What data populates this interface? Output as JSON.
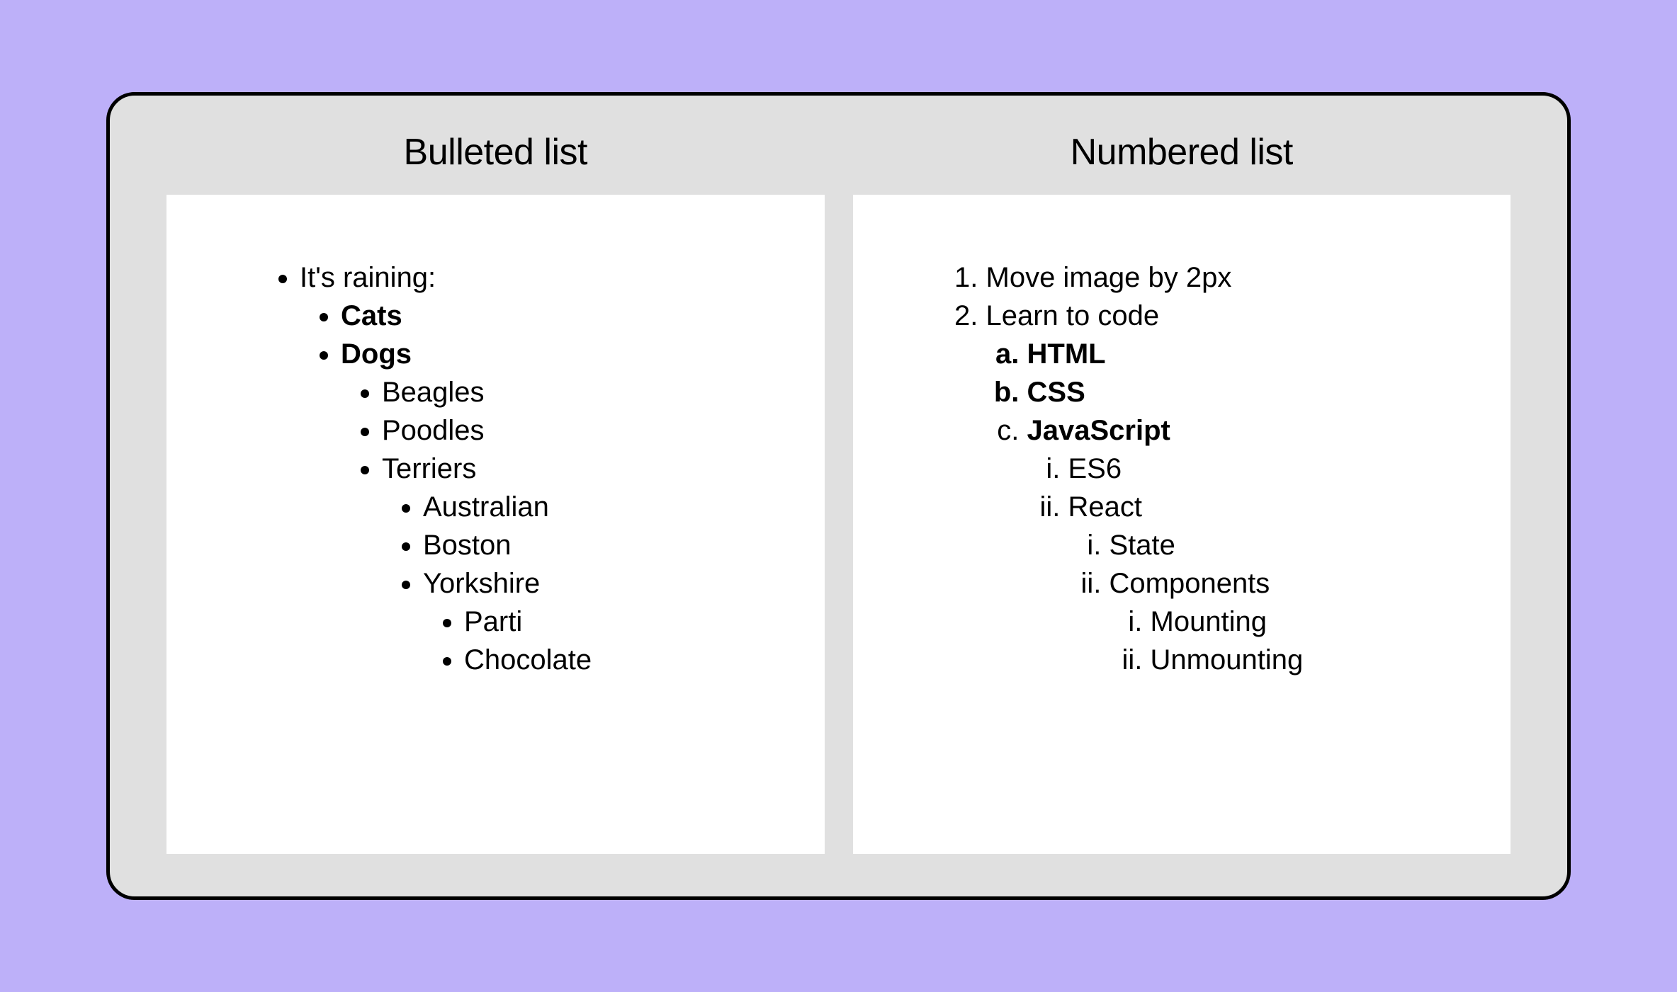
{
  "headings": {
    "bulleted": "Bulleted list",
    "numbered": "Numbered list"
  },
  "bulleted": {
    "intro": "It's raining:",
    "cats": "Cats",
    "dogs": "Dogs",
    "dog_breeds": {
      "beagles": "Beagles",
      "poodles": "Poodles",
      "terriers": "Terriers",
      "terrier_types": {
        "australian": "Australian",
        "boston": "Boston",
        "yorkshire": "Yorkshire",
        "yorkshire_colors": {
          "parti": "Parti",
          "chocolate": "Chocolate"
        }
      }
    }
  },
  "numbered": {
    "item1": "Move image by 2px",
    "item2": "Learn to code",
    "langs": {
      "html": "HTML",
      "css": "CSS",
      "js": "JavaScript",
      "js_topics": {
        "es6": "ES6",
        "react": "React",
        "react_topics": {
          "state": "State",
          "components": "Components",
          "component_topics": {
            "mounting": "Mounting",
            "unmounting": "Unmounting"
          }
        }
      }
    }
  }
}
